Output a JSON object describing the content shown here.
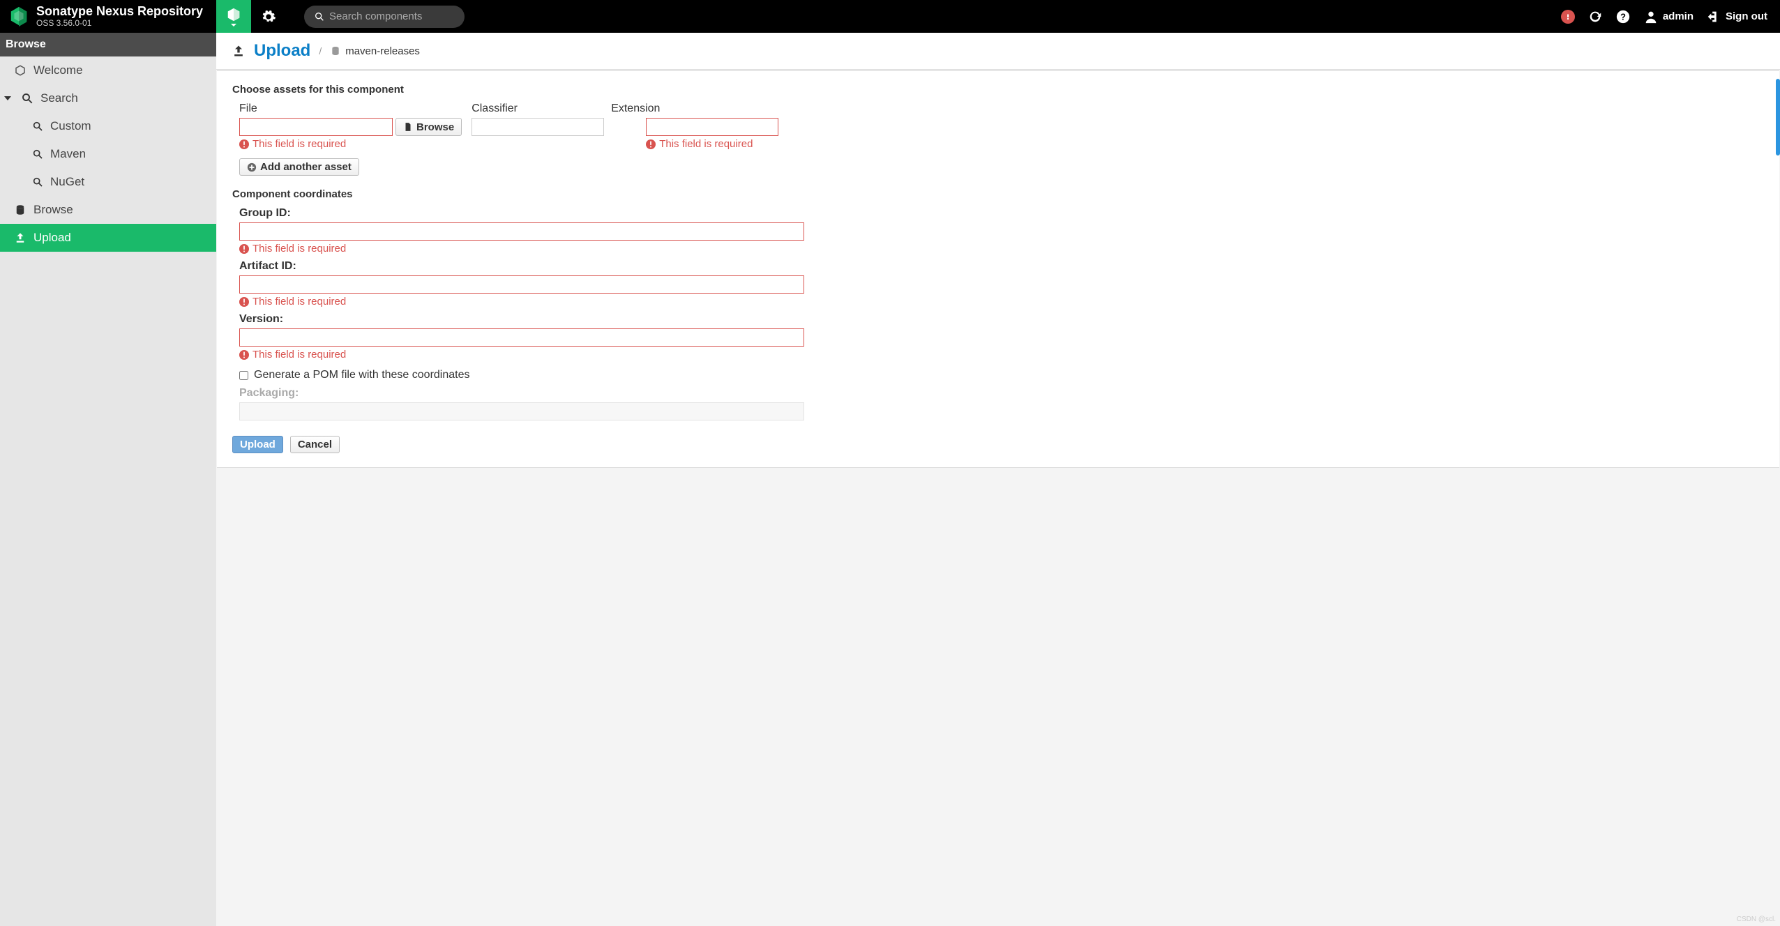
{
  "brand": {
    "title": "Sonatype Nexus Repository",
    "sub": "OSS 3.56.0-01"
  },
  "search": {
    "placeholder": "Search components"
  },
  "user": {
    "name": "admin",
    "signout": "Sign out"
  },
  "sidebar": {
    "header": "Browse",
    "items": [
      {
        "label": "Welcome",
        "icon": "hexagon"
      },
      {
        "label": "Search",
        "icon": "magnify",
        "expandable": true,
        "expanded": true
      },
      {
        "label": "Custom",
        "icon": "magnify",
        "indent": true
      },
      {
        "label": "Maven",
        "icon": "magnify",
        "indent": true
      },
      {
        "label": "NuGet",
        "icon": "magnify",
        "indent": true
      },
      {
        "label": "Browse",
        "icon": "db"
      },
      {
        "label": "Upload",
        "icon": "upload",
        "active": true
      }
    ]
  },
  "crumb": {
    "title": "Upload",
    "repo": "maven-releases"
  },
  "form": {
    "assetsTitle": "Choose assets for this component",
    "fileLabel": "File",
    "classifierLabel": "Classifier",
    "extensionLabel": "Extension",
    "browse": "Browse",
    "addAnother": "Add another asset",
    "required": "This field is required",
    "coordTitle": "Component coordinates",
    "groupId": "Group ID:",
    "artifactId": "Artifact ID:",
    "version": "Version:",
    "genPom": "Generate a POM file with these coordinates",
    "packaging": "Packaging:",
    "upload": "Upload",
    "cancel": "Cancel"
  },
  "watermark": "CSDN @scl."
}
